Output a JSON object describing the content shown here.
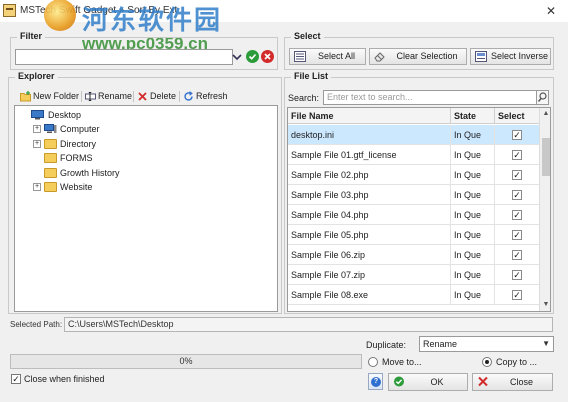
{
  "window": {
    "title": "MSTech Swift Gadget » Sort By Ext",
    "close_glyph": "✕",
    "watermark_cn": "河东软件园",
    "watermark_url": "www.pc0359.cn"
  },
  "filter": {
    "label": "Filter",
    "value": ""
  },
  "select_group": {
    "label": "Select",
    "buttons": {
      "select_all": "Select All",
      "clear_selection": "Clear Selection",
      "select_inverse": "Select Inverse"
    }
  },
  "explorer": {
    "label": "Explorer",
    "toolbar": {
      "new_folder": "New Folder",
      "rename": "Rename",
      "delete": "Delete",
      "refresh": "Refresh"
    },
    "tree": [
      {
        "label": "Desktop",
        "icon": "desktop-icon",
        "expander": ""
      },
      {
        "label": "Computer",
        "icon": "computer-icon",
        "expander": "+"
      },
      {
        "label": "Directory",
        "icon": "folder-icon",
        "expander": "+"
      },
      {
        "label": "FORMS",
        "icon": "folder-icon",
        "expander": ""
      },
      {
        "label": "Growth History",
        "icon": "folder-icon",
        "expander": ""
      },
      {
        "label": "Website",
        "icon": "folder-icon",
        "expander": "+"
      }
    ]
  },
  "file_list": {
    "label": "File List",
    "search_label": "Search:",
    "search_placeholder": "Enter text to search...",
    "columns": [
      "File Name",
      "State",
      "Select"
    ],
    "rows": [
      {
        "name": "desktop.ini",
        "state": "In Que",
        "checked": true
      },
      {
        "name": "Sample File 01.gtf_license",
        "state": "In Que",
        "checked": true
      },
      {
        "name": "Sample File 02.php",
        "state": "In Que",
        "checked": true
      },
      {
        "name": "Sample File 03.php",
        "state": "In Que",
        "checked": true
      },
      {
        "name": "Sample File 04.php",
        "state": "In Que",
        "checked": true
      },
      {
        "name": "Sample File 05.php",
        "state": "In Que",
        "checked": true
      },
      {
        "name": "Sample File 06.zip",
        "state": "In Que",
        "checked": true
      },
      {
        "name": "Sample File 07.zip",
        "state": "In Que",
        "checked": true
      },
      {
        "name": "Sample File 08.exe",
        "state": "In Que",
        "checked": true
      }
    ]
  },
  "selected_path": {
    "label": "Selected Path:",
    "value": "C:\\Users\\MSTech\\Desktop"
  },
  "duplicate": {
    "label": "Duplicate:",
    "value": "Rename"
  },
  "progress": {
    "percent": 0,
    "text": "0%"
  },
  "options": {
    "move_to": "Move to...",
    "copy_to": "Copy to ...",
    "selected": "copy"
  },
  "close_when_finished": {
    "label": "Close when finished",
    "checked": true
  },
  "actions": {
    "ok": "OK",
    "close": "Close",
    "help": "?"
  },
  "colors": {
    "selection": "#cce8ff",
    "ok_green": "#2c9b3a",
    "close_red": "#d12b2b",
    "help_blue": "#2f6fd0"
  }
}
